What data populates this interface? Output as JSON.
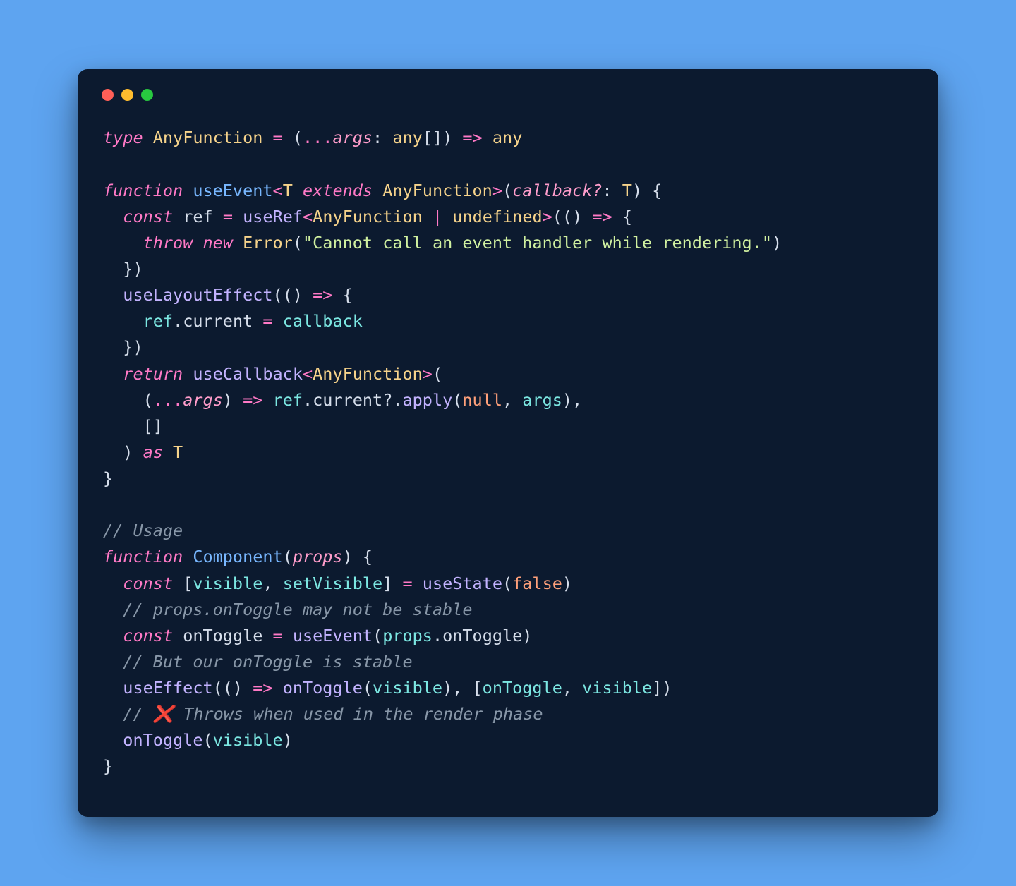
{
  "window": {
    "traffic_lights": [
      "close",
      "minimize",
      "zoom"
    ]
  },
  "code": {
    "lines": [
      [
        {
          "cls": "kw",
          "t": "type"
        },
        {
          "cls": "pun",
          "t": " "
        },
        {
          "cls": "typ",
          "t": "AnyFunction"
        },
        {
          "cls": "pun",
          "t": " "
        },
        {
          "cls": "op",
          "t": "="
        },
        {
          "cls": "pun",
          "t": " ("
        },
        {
          "cls": "op",
          "t": "..."
        },
        {
          "cls": "par",
          "t": "args"
        },
        {
          "cls": "pun",
          "t": ": "
        },
        {
          "cls": "typ",
          "t": "any"
        },
        {
          "cls": "pun",
          "t": "[]) "
        },
        {
          "cls": "op",
          "t": "=>"
        },
        {
          "cls": "pun",
          "t": " "
        },
        {
          "cls": "typ",
          "t": "any"
        }
      ],
      [],
      [
        {
          "cls": "kw",
          "t": "function"
        },
        {
          "cls": "pun",
          "t": " "
        },
        {
          "cls": "fn",
          "t": "useEvent"
        },
        {
          "cls": "op",
          "t": "<"
        },
        {
          "cls": "typ",
          "t": "T"
        },
        {
          "cls": "pun",
          "t": " "
        },
        {
          "cls": "kw",
          "t": "extends"
        },
        {
          "cls": "pun",
          "t": " "
        },
        {
          "cls": "typ",
          "t": "AnyFunction"
        },
        {
          "cls": "op",
          "t": ">"
        },
        {
          "cls": "pun",
          "t": "("
        },
        {
          "cls": "par",
          "t": "callback?"
        },
        {
          "cls": "pun",
          "t": ": "
        },
        {
          "cls": "typ",
          "t": "T"
        },
        {
          "cls": "pun",
          "t": ") {"
        }
      ],
      [
        {
          "cls": "pun",
          "t": "  "
        },
        {
          "cls": "kw",
          "t": "const"
        },
        {
          "cls": "pun",
          "t": " "
        },
        {
          "cls": "id",
          "t": "ref"
        },
        {
          "cls": "pun",
          "t": " "
        },
        {
          "cls": "op",
          "t": "="
        },
        {
          "cls": "pun",
          "t": " "
        },
        {
          "cls": "fnc",
          "t": "useRef"
        },
        {
          "cls": "op",
          "t": "<"
        },
        {
          "cls": "typ",
          "t": "AnyFunction"
        },
        {
          "cls": "pun",
          "t": " "
        },
        {
          "cls": "op",
          "t": "|"
        },
        {
          "cls": "pun",
          "t": " "
        },
        {
          "cls": "typ",
          "t": "undefined"
        },
        {
          "cls": "op",
          "t": ">"
        },
        {
          "cls": "pun",
          "t": "(() "
        },
        {
          "cls": "op",
          "t": "=>"
        },
        {
          "cls": "pun",
          "t": " {"
        }
      ],
      [
        {
          "cls": "pun",
          "t": "    "
        },
        {
          "cls": "kw",
          "t": "throw"
        },
        {
          "cls": "pun",
          "t": " "
        },
        {
          "cls": "kw",
          "t": "new"
        },
        {
          "cls": "pun",
          "t": " "
        },
        {
          "cls": "typ",
          "t": "Error"
        },
        {
          "cls": "pun",
          "t": "("
        },
        {
          "cls": "str",
          "t": "\"Cannot call an event handler while rendering.\""
        },
        {
          "cls": "pun",
          "t": ")"
        }
      ],
      [
        {
          "cls": "pun",
          "t": "  })"
        }
      ],
      [
        {
          "cls": "pun",
          "t": "  "
        },
        {
          "cls": "fnc",
          "t": "useLayoutEffect"
        },
        {
          "cls": "pun",
          "t": "(() "
        },
        {
          "cls": "op",
          "t": "=>"
        },
        {
          "cls": "pun",
          "t": " {"
        }
      ],
      [
        {
          "cls": "pun",
          "t": "    "
        },
        {
          "cls": "cyan",
          "t": "ref"
        },
        {
          "cls": "pun",
          "t": "."
        },
        {
          "cls": "id",
          "t": "current"
        },
        {
          "cls": "pun",
          "t": " "
        },
        {
          "cls": "op",
          "t": "="
        },
        {
          "cls": "pun",
          "t": " "
        },
        {
          "cls": "cyan",
          "t": "callback"
        }
      ],
      [
        {
          "cls": "pun",
          "t": "  })"
        }
      ],
      [
        {
          "cls": "pun",
          "t": "  "
        },
        {
          "cls": "kw",
          "t": "return"
        },
        {
          "cls": "pun",
          "t": " "
        },
        {
          "cls": "fnc",
          "t": "useCallback"
        },
        {
          "cls": "op",
          "t": "<"
        },
        {
          "cls": "typ",
          "t": "AnyFunction"
        },
        {
          "cls": "op",
          "t": ">"
        },
        {
          "cls": "pun",
          "t": "("
        }
      ],
      [
        {
          "cls": "pun",
          "t": "    ("
        },
        {
          "cls": "op",
          "t": "..."
        },
        {
          "cls": "par",
          "t": "args"
        },
        {
          "cls": "pun",
          "t": ") "
        },
        {
          "cls": "op",
          "t": "=>"
        },
        {
          "cls": "pun",
          "t": " "
        },
        {
          "cls": "cyan",
          "t": "ref"
        },
        {
          "cls": "pun",
          "t": "."
        },
        {
          "cls": "id",
          "t": "current"
        },
        {
          "cls": "pun",
          "t": "?."
        },
        {
          "cls": "fnc",
          "t": "apply"
        },
        {
          "cls": "pun",
          "t": "("
        },
        {
          "cls": "num",
          "t": "null"
        },
        {
          "cls": "pun",
          "t": ", "
        },
        {
          "cls": "cyan",
          "t": "args"
        },
        {
          "cls": "pun",
          "t": "),"
        }
      ],
      [
        {
          "cls": "pun",
          "t": "    []"
        }
      ],
      [
        {
          "cls": "pun",
          "t": "  ) "
        },
        {
          "cls": "kw",
          "t": "as"
        },
        {
          "cls": "pun",
          "t": " "
        },
        {
          "cls": "typ",
          "t": "T"
        }
      ],
      [
        {
          "cls": "pun",
          "t": "}"
        }
      ],
      [],
      [
        {
          "cls": "cmt",
          "t": "// Usage"
        }
      ],
      [
        {
          "cls": "kw",
          "t": "function"
        },
        {
          "cls": "pun",
          "t": " "
        },
        {
          "cls": "fn",
          "t": "Component"
        },
        {
          "cls": "pun",
          "t": "("
        },
        {
          "cls": "par",
          "t": "props"
        },
        {
          "cls": "pun",
          "t": ") {"
        }
      ],
      [
        {
          "cls": "pun",
          "t": "  "
        },
        {
          "cls": "kw",
          "t": "const"
        },
        {
          "cls": "pun",
          "t": " ["
        },
        {
          "cls": "cyan",
          "t": "visible"
        },
        {
          "cls": "pun",
          "t": ", "
        },
        {
          "cls": "cyan",
          "t": "setVisible"
        },
        {
          "cls": "pun",
          "t": "] "
        },
        {
          "cls": "op",
          "t": "="
        },
        {
          "cls": "pun",
          "t": " "
        },
        {
          "cls": "fnc",
          "t": "useState"
        },
        {
          "cls": "pun",
          "t": "("
        },
        {
          "cls": "num",
          "t": "false"
        },
        {
          "cls": "pun",
          "t": ")"
        }
      ],
      [
        {
          "cls": "pun",
          "t": "  "
        },
        {
          "cls": "cmt",
          "t": "// props.onToggle may not be stable"
        }
      ],
      [
        {
          "cls": "pun",
          "t": "  "
        },
        {
          "cls": "kw",
          "t": "const"
        },
        {
          "cls": "pun",
          "t": " "
        },
        {
          "cls": "id",
          "t": "onToggle"
        },
        {
          "cls": "pun",
          "t": " "
        },
        {
          "cls": "op",
          "t": "="
        },
        {
          "cls": "pun",
          "t": " "
        },
        {
          "cls": "fnc",
          "t": "useEvent"
        },
        {
          "cls": "pun",
          "t": "("
        },
        {
          "cls": "cyan",
          "t": "props"
        },
        {
          "cls": "pun",
          "t": "."
        },
        {
          "cls": "id",
          "t": "onToggle"
        },
        {
          "cls": "pun",
          "t": ")"
        }
      ],
      [
        {
          "cls": "pun",
          "t": "  "
        },
        {
          "cls": "cmt",
          "t": "// But our onToggle is stable"
        }
      ],
      [
        {
          "cls": "pun",
          "t": "  "
        },
        {
          "cls": "fnc",
          "t": "useEffect"
        },
        {
          "cls": "pun",
          "t": "(() "
        },
        {
          "cls": "op",
          "t": "=>"
        },
        {
          "cls": "pun",
          "t": " "
        },
        {
          "cls": "fnc",
          "t": "onToggle"
        },
        {
          "cls": "pun",
          "t": "("
        },
        {
          "cls": "cyan",
          "t": "visible"
        },
        {
          "cls": "pun",
          "t": "), ["
        },
        {
          "cls": "cyan",
          "t": "onToggle"
        },
        {
          "cls": "pun",
          "t": ", "
        },
        {
          "cls": "cyan",
          "t": "visible"
        },
        {
          "cls": "pun",
          "t": "])"
        }
      ],
      [
        {
          "cls": "pun",
          "t": "  "
        },
        {
          "cls": "cmt",
          "t": "// ❌ Throws when used in the render phase"
        }
      ],
      [
        {
          "cls": "pun",
          "t": "  "
        },
        {
          "cls": "fnc",
          "t": "onToggle"
        },
        {
          "cls": "pun",
          "t": "("
        },
        {
          "cls": "cyan",
          "t": "visible"
        },
        {
          "cls": "pun",
          "t": ")"
        }
      ],
      [
        {
          "cls": "pun",
          "t": "}"
        }
      ]
    ]
  }
}
